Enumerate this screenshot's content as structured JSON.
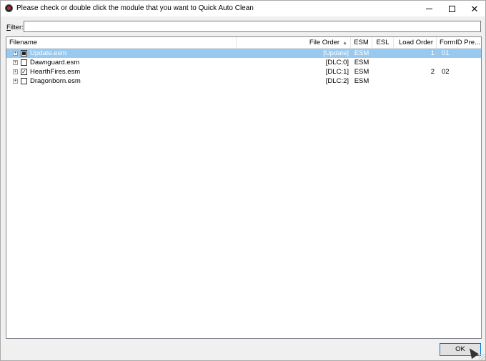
{
  "window": {
    "title": "Please check or double click the module that you want to Quick Auto Clean",
    "minimize_glyph": "—",
    "maximize_glyph": "☐",
    "close_glyph": "✕"
  },
  "filter": {
    "label_accel": "F",
    "label_rest": "ilter:",
    "value": "",
    "placeholder": ""
  },
  "table": {
    "columns": [
      {
        "label": "Filename"
      },
      {
        "label": "File Order",
        "sort": "ascending"
      },
      {
        "label": "ESM"
      },
      {
        "label": "ESL"
      },
      {
        "label": "Load Order"
      },
      {
        "label": "FormID Pre..."
      }
    ],
    "rows": [
      {
        "filename": "Update.esm",
        "file_order": "[Update]",
        "esm": "ESM",
        "esl": "",
        "load_order": "1",
        "formid_prefix": "01",
        "check_state": "partial",
        "selected": true
      },
      {
        "filename": "Dawnguard.esm",
        "file_order": "[DLC:0]",
        "esm": "ESM",
        "esl": "",
        "load_order": "",
        "formid_prefix": "",
        "check_state": "unchecked",
        "selected": false
      },
      {
        "filename": "HearthFires.esm",
        "file_order": "[DLC:1]",
        "esm": "ESM",
        "esl": "",
        "load_order": "2",
        "formid_prefix": "02",
        "check_state": "checked",
        "selected": false
      },
      {
        "filename": "Dragonborn.esm",
        "file_order": "[DLC:2]",
        "esm": "ESM",
        "esl": "",
        "load_order": "",
        "formid_prefix": "",
        "check_state": "unchecked",
        "selected": false
      }
    ]
  },
  "buttons": {
    "ok_label": "OK"
  },
  "colors": {
    "selection": "#99c9ef",
    "accent": "#0078d7",
    "window_bg": "#f0f0f0"
  }
}
